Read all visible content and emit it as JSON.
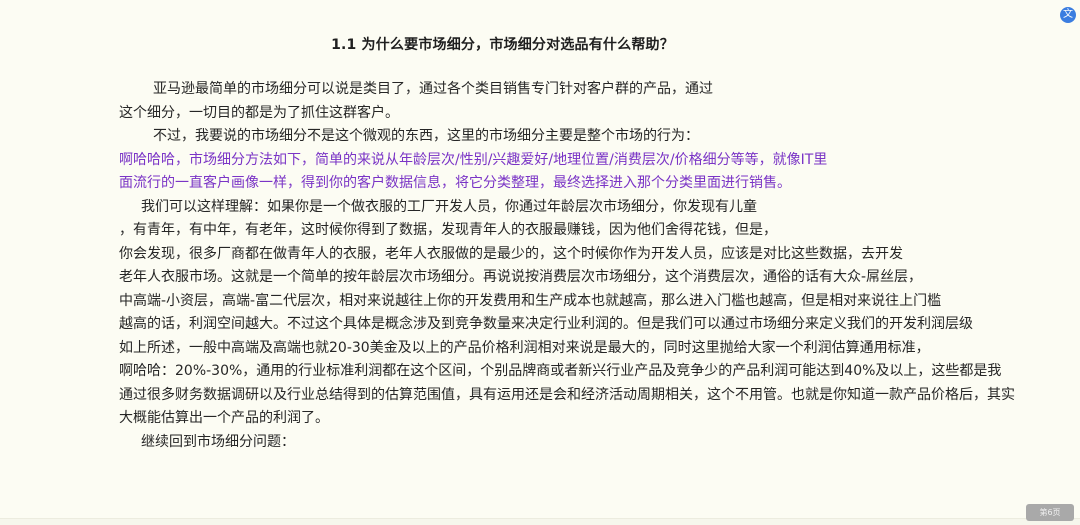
{
  "document": {
    "title": "1.1  为什么要市场细分，市场细分对选品有什么帮助？",
    "lines": [
      {
        "text": "亚马逊最简单的市场细分可以说是类目了，通过各个类目销售专门针对客户群的产品，通过",
        "purple": false
      },
      {
        "text": "这个细分，一切目的都是为了抓住这群客户。",
        "purple": false
      },
      {
        "text": "不过，我要说的市场细分不是这个微观的东西，这里的市场细分主要是整个市场的行为：",
        "purple": false
      },
      {
        "text": "啊哈哈哈，市场细分方法如下，简单的来说从年龄层次/性别/兴趣爱好/地理位置/消费层次/价格细分等等，就像IT里",
        "purple": true
      },
      {
        "text": "面流行的一直客户画像一样，得到你的客户数据信息，将它分类整理，最终选择进入那个分类里面进行销售。",
        "purple": true
      },
      {
        "text": "我们可以这样理解：如果你是一个做衣服的工厂开发人员，你通过年龄层次市场细分，你发现有儿童",
        "purple": false
      },
      {
        "text": "，有青年，有中年，有老年，这时候你得到了数据，发现青年人的衣服最赚钱，因为他们舍得花钱，但是，",
        "purple": false
      },
      {
        "text": "你会发现，很多厂商都在做青年人的衣服，老年人衣服做的是最少的，这个时候你作为开发人员，应该是对比这些数据，去开发",
        "purple": false
      },
      {
        "text": "老年人衣服市场。这就是一个简单的按年龄层次市场细分。再说说按消费层次市场细分，这个消费层次，通俗的话有大众-屌丝层，",
        "purple": false
      },
      {
        "text": "中高端-小资层，高端-富二代层次，相对来说越往上你的开发费用和生产成本也就越高，那么进入门槛也越高，但是相对来说往上门槛",
        "purple": false
      },
      {
        "text": "越高的话，利润空间越大。不过这个具体是概念涉及到竞争数量来决定行业利润的。但是我们可以通过市场细分来定义我们的开发利润层级",
        "purple": false
      },
      {
        "text": "如上所述，一般中高端及高端也就20-30美金及以上的产品价格利润相对来说是最大的，同时这里抛给大家一个利润估算通用标准，",
        "purple": false
      },
      {
        "text": "啊哈哈：20%-30%，通用的行业标准利润都在这个区间，个别品牌商或者新兴行业产品及竞争少的产品利润可能达到40%及以上，这些都是我",
        "purple": false
      },
      {
        "text": "通过很多财务数据调研以及行业总结得到的估算范围值，具有运用还是会和经济活动周期相关，这个不用管。也就是你知道一款产品价格后，其实",
        "purple": false
      },
      {
        "text": "大概能估算出一个产品的利润了。",
        "purple": false
      },
      {
        "text": "继续回到市场细分问题：",
        "purple": false
      }
    ]
  },
  "ui": {
    "corner_icon": "translate-icon",
    "corner_glyph": "文",
    "page_badge": "第6页"
  }
}
